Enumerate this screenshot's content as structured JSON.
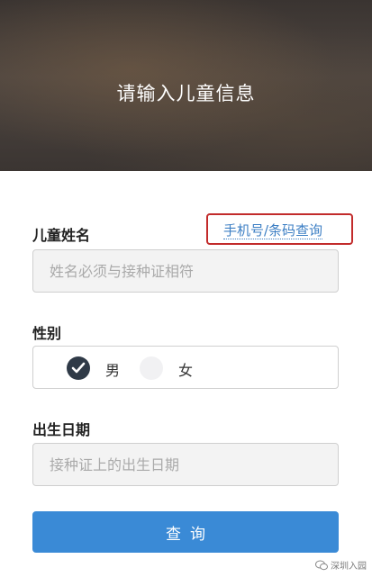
{
  "header": {
    "title": "请输入儿童信息"
  },
  "form": {
    "name_label": "儿童姓名",
    "lookup_link": "手机号/条码查询",
    "name_placeholder": "姓名必须与接种证相符",
    "gender_label": "性别",
    "gender_options": [
      {
        "label": "男",
        "selected": true
      },
      {
        "label": "女",
        "selected": false
      }
    ],
    "birth_label": "出生日期",
    "birth_placeholder": "接种证上的出生日期",
    "submit_label": "查询"
  },
  "watermark": {
    "text": "深圳入园",
    "icon": "wechat-icon"
  },
  "colors": {
    "accent": "#3a8ad6",
    "link": "#3d7fc4",
    "highlight_border": "#c22b2b",
    "radio_checked": "#2f3a47"
  }
}
